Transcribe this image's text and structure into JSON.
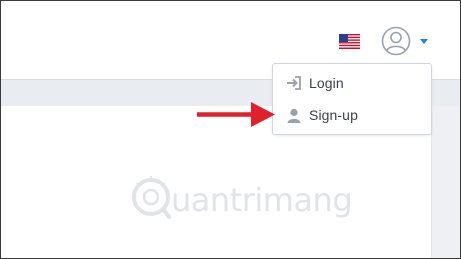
{
  "header": {
    "language_flag": "us-flag-icon",
    "account_icon": "user-circle-icon",
    "account_caret_color": "#1e88d6"
  },
  "account_menu": {
    "items": [
      {
        "label": "Login",
        "icon": "login-icon"
      },
      {
        "label": "Sign-up",
        "icon": "user-icon"
      }
    ]
  },
  "annotation": {
    "arrow_color": "#e0212b"
  },
  "watermark": {
    "text": "uantrimang",
    "logo": "quantrimang-logo"
  }
}
